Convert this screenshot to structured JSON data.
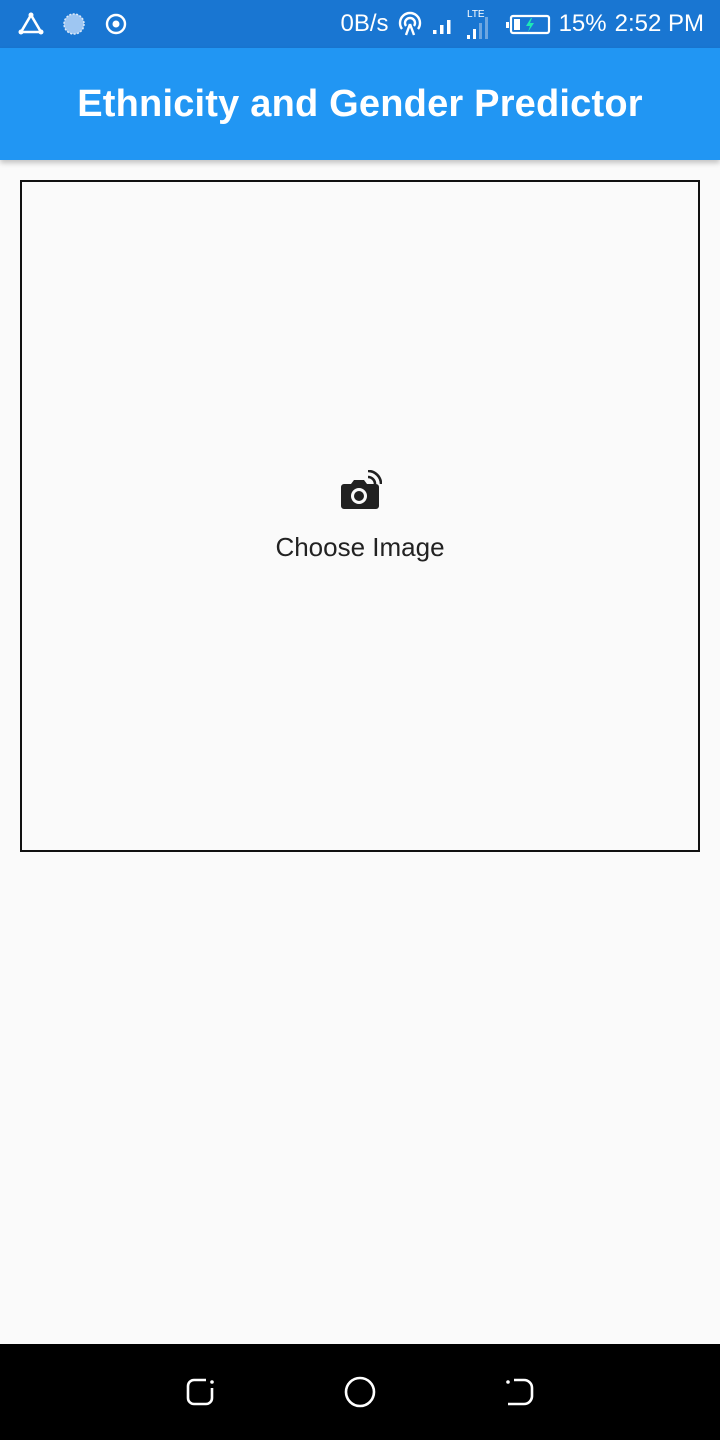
{
  "status_bar": {
    "net_speed": "0B/s",
    "network_type": "LTE",
    "battery": "15%",
    "time": "2:52 PM",
    "icons": [
      "triangle-icon",
      "sun-icon",
      "target-icon",
      "hotspot-icon",
      "signal-icon",
      "lte-signal-icon",
      "battery-charging-icon"
    ]
  },
  "app_bar": {
    "title": "Ethnicity and Gender Predictor",
    "color": "#2196f3"
  },
  "image_picker": {
    "icon": "camera-icon",
    "label": "Choose Image"
  },
  "nav_bar": {
    "buttons": [
      "recent-apps-icon",
      "home-icon",
      "back-icon"
    ]
  }
}
